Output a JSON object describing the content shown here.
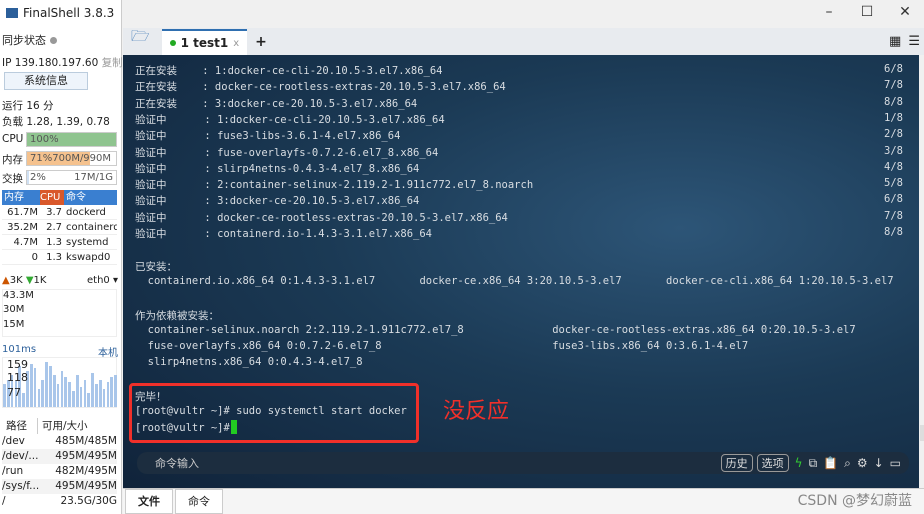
{
  "app": {
    "title": "FinalShell 3.8.3"
  },
  "sidebar": {
    "sync_label": "同步状态",
    "ip": "IP 139.180.197.60",
    "copy": "复制",
    "sysinfo": "系统信息",
    "uptime": "运行 16 分",
    "load": "负载 1.28, 1.39, 0.78",
    "cpu_label": "CPU",
    "cpu_text": "100%",
    "cpu_pct": 100,
    "mem_label": "内存",
    "mem_text": "71%700M/990M",
    "mem_pct": 71,
    "swap_label": "交换",
    "swap_pct_text": "2%",
    "swap_text": "17M/1G",
    "swap_pct": 2,
    "proc_headers": [
      "内存",
      "CPU",
      "命令"
    ],
    "procs": [
      [
        "61.7M",
        "3.7",
        "dockerd"
      ],
      [
        "35.2M",
        "2.7",
        "containerd"
      ],
      [
        "4.7M",
        "1.3",
        "systemd"
      ],
      [
        "0",
        "1.3",
        "kswapd0"
      ]
    ],
    "net_up": "3K",
    "net_down": "1K",
    "iface": "eth0",
    "net_ticks": [
      "43.3M",
      "30M",
      "15M"
    ],
    "ping": "101ms",
    "ping_host": "本机",
    "ping_ticks": [
      "159",
      "118",
      "77"
    ],
    "ping_values": [
      110,
      120,
      130,
      118,
      150,
      90,
      140,
      155,
      145,
      100,
      120,
      160,
      150,
      130,
      110,
      140,
      125,
      115,
      95,
      130,
      105,
      120,
      90,
      135,
      110,
      120,
      100,
      115,
      125,
      130
    ],
    "disk_headers": [
      "路径",
      "可用/大小"
    ],
    "disks": [
      [
        "/dev",
        "485M/485M"
      ],
      [
        "/dev/...",
        "495M/495M"
      ],
      [
        "/run",
        "482M/495M"
      ],
      [
        "/sys/f...",
        "495M/495M"
      ],
      [
        "/",
        "23.5G/30G"
      ]
    ]
  },
  "tabs": [
    {
      "label": "1 test1",
      "close": "x"
    }
  ],
  "terminal": {
    "lines": [
      [
        "正在安装    : 1:docker-ce-cli-20.10.5-3.el7.x86_64",
        "6/8"
      ],
      [
        "正在安装    : docker-ce-rootless-extras-20.10.5-3.el7.x86_64",
        "7/8"
      ],
      [
        "正在安装    : 3:docker-ce-20.10.5-3.el7.x86_64",
        "8/8"
      ],
      [
        "验证中      : 1:docker-ce-cli-20.10.5-3.el7.x86_64",
        "1/8"
      ],
      [
        "验证中      : fuse3-libs-3.6.1-4.el7.x86_64",
        "2/8"
      ],
      [
        "验证中      : fuse-overlayfs-0.7.2-6.el7_8.x86_64",
        "3/8"
      ],
      [
        "验证中      : slirp4netns-0.4.3-4.el7_8.x86_64",
        "4/8"
      ],
      [
        "验证中      : 2:container-selinux-2.119.2-1.911c772.el7_8.noarch",
        "5/8"
      ],
      [
        "验证中      : 3:docker-ce-20.10.5-3.el7.x86_64",
        "6/8"
      ],
      [
        "验证中      : docker-ce-rootless-extras-20.10.5-3.el7.x86_64",
        "7/8"
      ],
      [
        "验证中      : containerd.io-1.4.3-3.1.el7.x86_64",
        "8/8"
      ],
      [
        "",
        ""
      ],
      [
        "已安装：",
        ""
      ],
      [
        "  containerd.io.x86_64 0:1.4.3-3.1.el7       docker-ce.x86_64 3:20.10.5-3.el7       docker-ce-cli.x86_64 1:20.10.5-3.el7",
        ""
      ],
      [
        "",
        ""
      ],
      [
        "作为依赖被安装：",
        ""
      ],
      [
        "  container-selinux.noarch 2:2.119.2-1.911c772.el7_8              docker-ce-rootless-extras.x86_64 0:20.10.5-3.el7",
        ""
      ],
      [
        "  fuse-overlayfs.x86_64 0:0.7.2-6.el7_8                           fuse3-libs.x86_64 0:3.6.1-4.el7",
        ""
      ],
      [
        "  slirp4netns.x86_64 0:0.4.3-4.el7_8",
        ""
      ],
      [
        "",
        ""
      ],
      [
        "完毕！",
        ""
      ],
      [
        "[root@vultr ~]# sudo systemctl start docker",
        ""
      ],
      [
        "[root@vultr ~]# ",
        ""
      ]
    ],
    "annotation": "没反应"
  },
  "cmdbar": {
    "placeholder": "命令输入",
    "history": "历史",
    "options": "选项"
  },
  "bottom_tabs": [
    "文件",
    "命令"
  ],
  "watermark": "CSDN @梦幻蔚蓝"
}
